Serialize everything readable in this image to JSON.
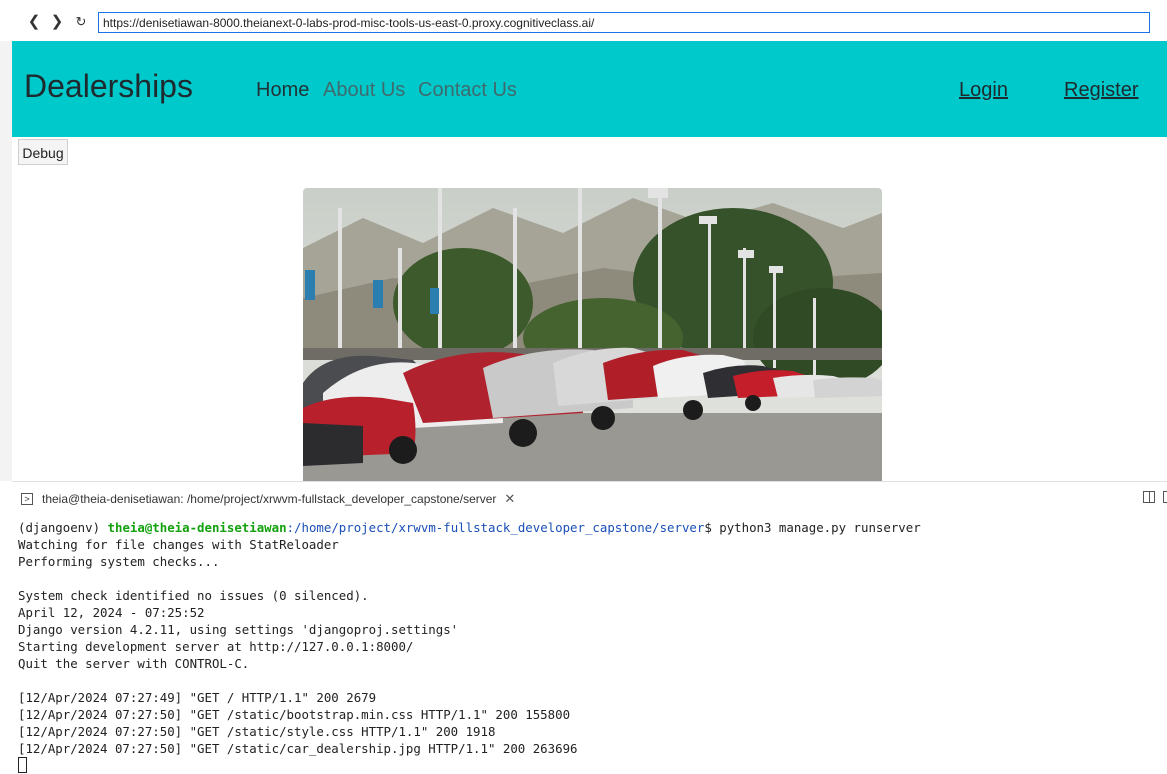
{
  "browser": {
    "url": "https://denisetiawan-8000.theianext-0-labs-prod-misc-tools-us-east-0.proxy.cognitiveclass.ai/",
    "back_icon": "chevron-left-icon",
    "forward_icon": "chevron-right-icon",
    "reload_icon": "reload-icon"
  },
  "site": {
    "brand": "Dealerships",
    "nav": {
      "home": "Home",
      "about": "About Us",
      "contact": "Contact Us",
      "login": "Login",
      "register": "Register"
    },
    "debug_label": "Debug",
    "accent_color": "#00c9cc"
  },
  "terminal": {
    "tab_title": "theia@theia-denisetiawan: /home/project/xrwvm-fullstack_developer_capstone/server",
    "prompt_env": "(djangoenv) ",
    "prompt_user": "theia@theia-denisetiawan",
    "prompt_path": ":/home/project/xrwvm-fullstack_developer_capstone/server",
    "prompt_cmd": "$ python3 manage.py runserver",
    "lines": [
      "Watching for file changes with StatReloader",
      "Performing system checks...",
      "",
      "System check identified no issues (0 silenced).",
      "April 12, 2024 - 07:25:52",
      "Django version 4.2.11, using settings 'djangoproj.settings'",
      "Starting development server at http://127.0.0.1:8000/",
      "Quit the server with CONTROL-C.",
      "",
      "[12/Apr/2024 07:27:49] \"GET / HTTP/1.1\" 200 2679",
      "[12/Apr/2024 07:27:50] \"GET /static/bootstrap.min.css HTTP/1.1\" 200 155800",
      "[12/Apr/2024 07:27:50] \"GET /static/style.css HTTP/1.1\" 200 1918",
      "[12/Apr/2024 07:27:50] \"GET /static/car_dealership.jpg HTTP/1.1\" 200 263696"
    ]
  }
}
